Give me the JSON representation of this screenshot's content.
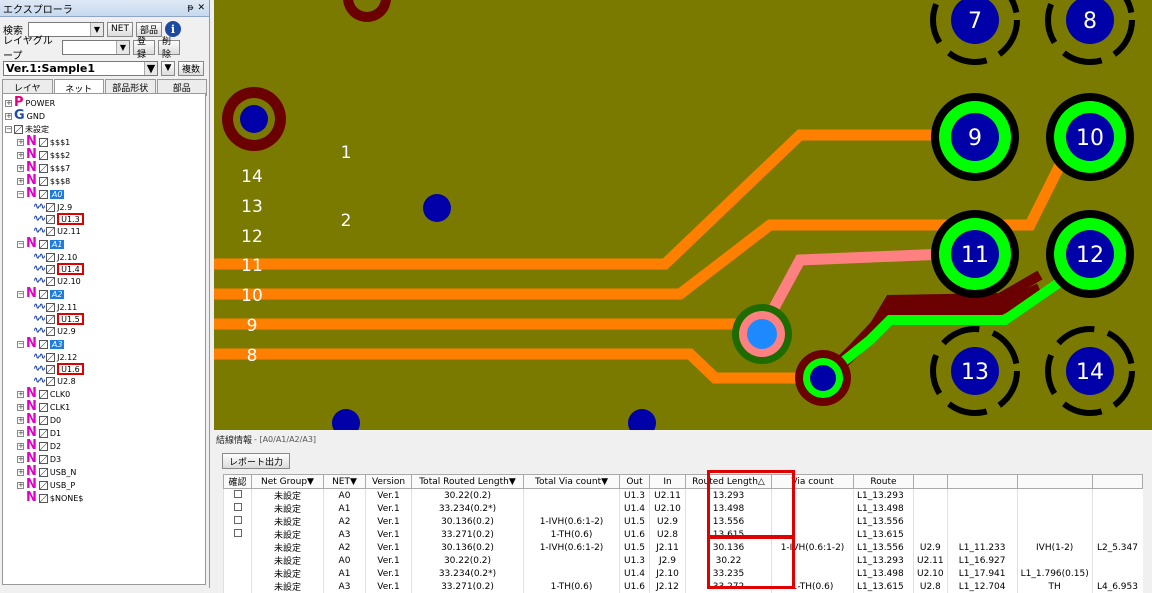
{
  "explorer": {
    "title": "エクスプローラ",
    "pin": "ᵽ",
    "close": "✕",
    "search_label": "検索",
    "net_button": "NET",
    "part_button": "部品",
    "info": "i",
    "layer_group_label": "レイヤグループ",
    "register_button": "登録",
    "delete_button": "削除",
    "version_value": "Ver.1:Sample1",
    "dropdown_arrow": "▼",
    "multi_button": "複数",
    "tabs": [
      "レイヤ",
      "ネット",
      "部品形状",
      "部品"
    ],
    "tree": {
      "power": "POWER",
      "gnd": "GND",
      "unset": "未設定",
      "nets": [
        "$$$1",
        "$$$2",
        "$$$7",
        "$$$8"
      ],
      "a0": "A0",
      "a0_children": [
        "J2.9",
        "U1.3",
        "U2.11"
      ],
      "a1": "A1",
      "a1_children": [
        "J2.10",
        "U1.4",
        "U2.10"
      ],
      "a2": "A2",
      "a2_children": [
        "J2.11",
        "U1.5",
        "U2.9"
      ],
      "a3": "A3",
      "a3_children": [
        "J2.12",
        "U1.6",
        "U2.8"
      ],
      "rest": [
        "CLK0",
        "CLK1",
        "D0",
        "D1",
        "D2",
        "D3",
        "USB_N",
        "USB_P",
        "$NONE$"
      ]
    }
  },
  "pcb": {
    "pins_right": [
      "7",
      "8",
      "9",
      "10",
      "11",
      "12",
      "13",
      "14"
    ],
    "labels_left": [
      "1",
      "14",
      "13",
      "2",
      "12",
      "11",
      "10",
      "9",
      "8"
    ],
    "colors": {
      "board": "#7a7a00",
      "trace": "#ff8000",
      "green": "#00ff00",
      "blue": "#0000a8",
      "maroon": "#6a0000"
    }
  },
  "wiring": {
    "title": "結線情報",
    "subtitle": "- [A0/A1/A2/A3]",
    "report_button": "レポート出力",
    "columns": [
      "確認",
      "Net Group▼",
      "NET▼",
      "Version",
      "Total Routed Length▼",
      "Total Via count▼",
      "Out",
      "In",
      "Routed Length△",
      "Via count",
      "Route"
    ],
    "rows": [
      {
        "cb": true,
        "group": "未設定",
        "net": "A0",
        "ver": "Ver.1",
        "total": "30.22(0.2)",
        "via": "",
        "out": "U1.3",
        "in": "U2.11",
        "routed": "13.293",
        "vc": "",
        "route": "L1_13.293",
        "e": [
          "",
          "",
          "",
          ""
        ]
      },
      {
        "cb": true,
        "group": "未設定",
        "net": "A1",
        "ver": "Ver.1",
        "total": "33.234(0.2*)",
        "via": "",
        "out": "U1.4",
        "in": "U2.10",
        "routed": "13.498",
        "vc": "",
        "route": "L1_13.498",
        "e": [
          "",
          "",
          "",
          ""
        ]
      },
      {
        "cb": true,
        "group": "未設定",
        "net": "A2",
        "ver": "Ver.1",
        "total": "30.136(0.2)",
        "via": "1-IVH(0.6:1-2)",
        "out": "U1.5",
        "in": "U2.9",
        "routed": "13.556",
        "vc": "",
        "route": "L1_13.556",
        "e": [
          "",
          "",
          "",
          ""
        ]
      },
      {
        "cb": true,
        "group": "未設定",
        "net": "A3",
        "ver": "Ver.1",
        "total": "33.271(0.2)",
        "via": "1-TH(0.6)",
        "out": "U1.6",
        "in": "U2.8",
        "routed": "13.615",
        "vc": "",
        "route": "L1_13.615",
        "e": [
          "",
          "",
          "",
          ""
        ]
      },
      {
        "cb": false,
        "group": "未設定",
        "net": "A2",
        "ver": "Ver.1",
        "total": "30.136(0.2)",
        "via": "1-IVH(0.6:1-2)",
        "out": "U1.5",
        "in": "J2.11",
        "routed": "30.136",
        "vc": "1-IVH(0.6:1-2)",
        "route": "L1_13.556",
        "e": [
          "U2.9",
          "L1_11.233",
          "IVH(1-2)",
          "L2_5.347"
        ]
      },
      {
        "cb": false,
        "group": "未設定",
        "net": "A0",
        "ver": "Ver.1",
        "total": "30.22(0.2)",
        "via": "",
        "out": "U1.3",
        "in": "J2.9",
        "routed": "30.22",
        "vc": "",
        "route": "L1_13.293",
        "e": [
          "U2.11",
          "L1_16.927",
          "",
          ""
        ]
      },
      {
        "cb": false,
        "group": "未設定",
        "net": "A1",
        "ver": "Ver.1",
        "total": "33.234(0.2*)",
        "via": "",
        "out": "U1.4",
        "in": "J2.10",
        "routed": "33.235",
        "vc": "",
        "route": "L1_13.498",
        "e": [
          "U2.10",
          "L1_17.941",
          "L1_1.796(0.15)",
          ""
        ]
      },
      {
        "cb": false,
        "group": "未設定",
        "net": "A3",
        "ver": "Ver.1",
        "total": "33.271(0.2)",
        "via": "1-TH(0.6)",
        "out": "U1.6",
        "in": "J2.12",
        "routed": "33.272",
        "vc": "1-TH(0.6)",
        "route": "L1_13.615",
        "e": [
          "U2.8",
          "L1_12.704",
          "TH",
          "L4_6.953"
        ]
      }
    ]
  }
}
